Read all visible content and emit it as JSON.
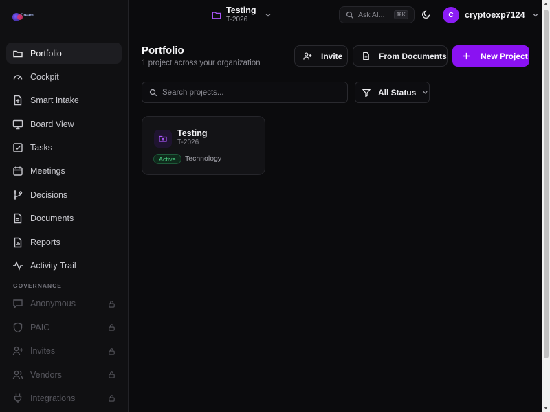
{
  "sidebar": {
    "logo_text": "Dream",
    "items": [
      {
        "label": "Portfolio",
        "icon": "folder-icon",
        "active": true
      },
      {
        "label": "Cockpit",
        "icon": "gauge-icon"
      },
      {
        "label": "Smart Intake",
        "icon": "file-upload-icon"
      },
      {
        "label": "Board View",
        "icon": "monitor-icon"
      },
      {
        "label": "Tasks",
        "icon": "checkbox-icon"
      },
      {
        "label": "Meetings",
        "icon": "calendar-icon"
      },
      {
        "label": "Decisions",
        "icon": "git-branch-icon"
      },
      {
        "label": "Documents",
        "icon": "document-icon"
      },
      {
        "label": "Reports",
        "icon": "chart-file-icon"
      },
      {
        "label": "Activity Trail",
        "icon": "activity-icon"
      }
    ],
    "governance_title": "GOVERNANCE",
    "governance_items": [
      {
        "label": "Anonymous",
        "icon": "chat-icon"
      },
      {
        "label": "PAIC",
        "icon": "shield-icon"
      },
      {
        "label": "Invites",
        "icon": "user-plus-icon"
      },
      {
        "label": "Vendors",
        "icon": "users-icon"
      },
      {
        "label": "Integrations",
        "icon": "plug-icon"
      }
    ]
  },
  "topbar": {
    "project_name": "Testing",
    "project_code": "T-2026",
    "ask_placeholder": "Ask AI...",
    "ask_shortcut": "⌘K",
    "user_initial": "C",
    "username": "cryptoexp7124"
  },
  "main": {
    "title": "Portfolio",
    "subtitle": "1 project across your organization",
    "invite_label": "Invite",
    "from_documents_label": "From Documents",
    "new_project_label": "New Project",
    "search_placeholder": "Search projects...",
    "status_filter": "All Status",
    "projects": [
      {
        "name": "Testing",
        "code": "T-2026",
        "status": "Active",
        "category": "Technology"
      }
    ]
  },
  "colors": {
    "accent": "#8a12f2",
    "active_badge": "#4ccf83",
    "background": "#0b0b0d"
  }
}
